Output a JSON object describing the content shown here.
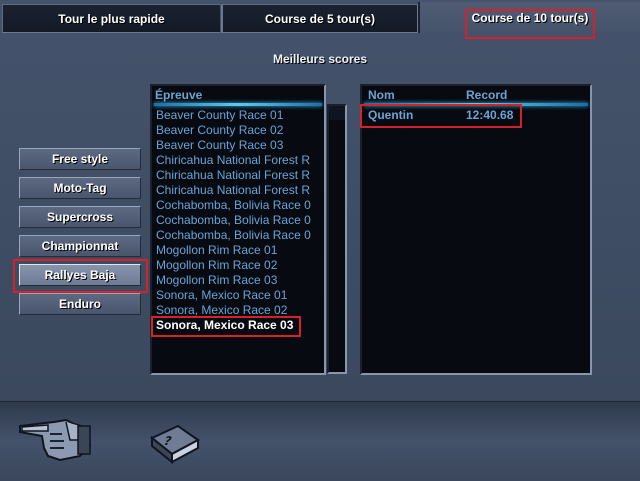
{
  "tabs": [
    {
      "label": "Tour le plus rapide"
    },
    {
      "label": "Course de 5 tour(s)"
    },
    {
      "label": "Course de 10 tour(s)"
    }
  ],
  "section_title": "Meilleurs scores",
  "categories": [
    {
      "label": "Free style"
    },
    {
      "label": "Moto-Tag"
    },
    {
      "label": "Supercross"
    },
    {
      "label": "Championnat"
    },
    {
      "label": "Rallyes Baja"
    },
    {
      "label": "Enduro"
    }
  ],
  "events": {
    "header": "Épreuve",
    "items": [
      "Beaver County Race 01",
      "Beaver County Race 02",
      "Beaver County Race 03",
      "Chiricahua National Forest R",
      "Chiricahua National Forest R",
      "Chiricahua National Forest R",
      "Cochabomba, Bolivia Race 0",
      "Cochabomba, Bolivia Race 0",
      "Cochabomba, Bolivia Race 0",
      "Mogollon Rim Race 01",
      "Mogollon Rim Race 02",
      "Mogollon Rim Race 03",
      "Sonora, Mexico Race 01",
      "Sonora, Mexico Race 02",
      "Sonora, Mexico Race 03"
    ]
  },
  "records": {
    "header_name": "Nom",
    "header_record": "Record",
    "rows": [
      {
        "name": "Quentin",
        "time": "12:40.68"
      }
    ]
  },
  "bottom_icons": [
    "pointing-hand-icon",
    "help-book-icon"
  ],
  "colors": {
    "accent_cyan": "#5ecbf2",
    "list_text": "#6aa4d6",
    "highlight_red": "#d8202a"
  }
}
